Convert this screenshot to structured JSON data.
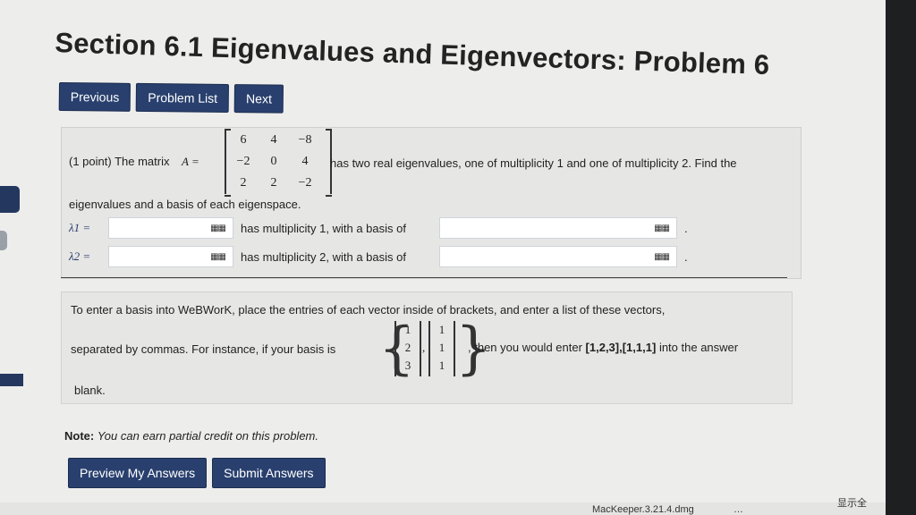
{
  "title": "Section 6.1 Eigenvalues and Eigenvectors: Problem 6",
  "nav": {
    "previous": "Previous",
    "problem_list": "Problem List",
    "next": "Next"
  },
  "problem": {
    "intro": "(1 point) The matrix",
    "matrix_label": "A =",
    "matrix": [
      [
        "6",
        "4",
        "−8"
      ],
      [
        "−2",
        "0",
        "4"
      ],
      [
        "2",
        "2",
        "−2"
      ]
    ],
    "text_after": "has two real eigenvalues, one of multiplicity 1 and one of multiplicity 2. Find the",
    "text_line2": "eigenvalues and a basis of each eigenspace.",
    "lambda1_label": "λ1 =",
    "lambda1_text": "has multiplicity 1, with a basis of",
    "lambda2_label": "λ2 =",
    "lambda2_text": "has multiplicity 2, with a basis of",
    "period": "."
  },
  "info": {
    "line1": "To enter a basis into WeBWorK, place the entries of each vector inside of brackets, and enter a list of these vectors,",
    "line2_pre": "separated by commas. For instance, if your basis is",
    "vector1": [
      "1",
      "2",
      "3"
    ],
    "vector2": [
      "1",
      "1",
      "1"
    ],
    "comma": ",",
    "line2_post": ", then you would enter",
    "example": "[1,2,3],[1,1,1]",
    "line2_end": "into the answer",
    "line3": "blank."
  },
  "note": {
    "label": "Note:",
    "text": "You can earn partial credit on this problem."
  },
  "actions": {
    "preview": "Preview My Answers",
    "submit": "Submit Answers"
  },
  "dock": {
    "item1": "MacKeeper.3.21.4.dmg",
    "item2": "…",
    "item3": "显示全"
  }
}
